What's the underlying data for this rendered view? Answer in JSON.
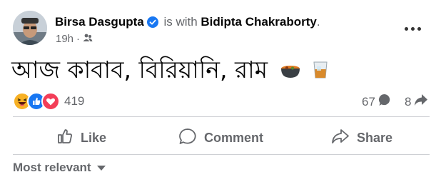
{
  "post": {
    "author": "Birsa Dasgupta",
    "with_text": "is with",
    "tagged": "Bidipta Chakraborty",
    "tagged_suffix": ".",
    "time": "19h",
    "separator": "·",
    "text": "আজ কাবাব, বিরিয়ানি, রাম",
    "emojis": [
      "curry-pot-icon",
      "whisky-glass-icon"
    ]
  },
  "stats": {
    "reactions_count": "419",
    "reaction_icons": [
      "haha-icon",
      "like-icon",
      "love-icon"
    ],
    "comments_count": "67",
    "shares_count": "8"
  },
  "actions": {
    "like": "Like",
    "comment": "Comment",
    "share": "Share"
  },
  "comments_filter": "Most relevant",
  "colors": {
    "like_blue": "#1877f2",
    "love_red": "#f33e58",
    "haha_yellow": "#f7b125",
    "secondary_text": "#65676b",
    "divider": "#ced0d4"
  }
}
